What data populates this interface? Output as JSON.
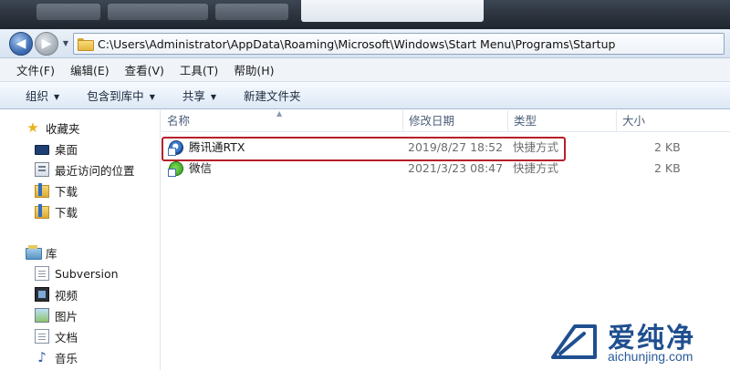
{
  "title_bar": {
    "tabs": [
      "",
      "",
      ""
    ]
  },
  "address_bar": {
    "path": "C:\\Users\\Administrator\\AppData\\Roaming\\Microsoft\\Windows\\Start Menu\\Programs\\Startup"
  },
  "menu": {
    "items": [
      "文件(F)",
      "编辑(E)",
      "查看(V)",
      "工具(T)",
      "帮助(H)"
    ]
  },
  "commands": {
    "organize": "组织",
    "include_in_library": "包含到库中",
    "share": "共享",
    "new_folder": "新建文件夹"
  },
  "sidebar": {
    "favorites_header": "收藏夹",
    "favorites": [
      "桌面",
      "最近访问的位置",
      "下载",
      "下载"
    ],
    "libraries_header": "库",
    "libraries": [
      "Subversion",
      "视频",
      "图片",
      "文档",
      "音乐"
    ]
  },
  "columns": {
    "name": "名称",
    "date": "修改日期",
    "type": "类型",
    "size": "大小"
  },
  "files": [
    {
      "name": "腾讯通RTX",
      "date": "2019/8/27 18:52",
      "type": "快捷方式",
      "size": "2 KB",
      "icon": "rtx-shortcut-icon",
      "highlighted": true
    },
    {
      "name": "微信",
      "date": "2021/3/23 08:47",
      "type": "快捷方式",
      "size": "2 KB",
      "icon": "wechat-shortcut-icon",
      "highlighted": false
    }
  ],
  "watermark": {
    "brand": "爱纯净",
    "url": "aichunjing.com",
    "color": "#1f4f8f"
  },
  "colors": {
    "highlight_border": "#b61f2a",
    "accent": "#3f6fb4"
  }
}
